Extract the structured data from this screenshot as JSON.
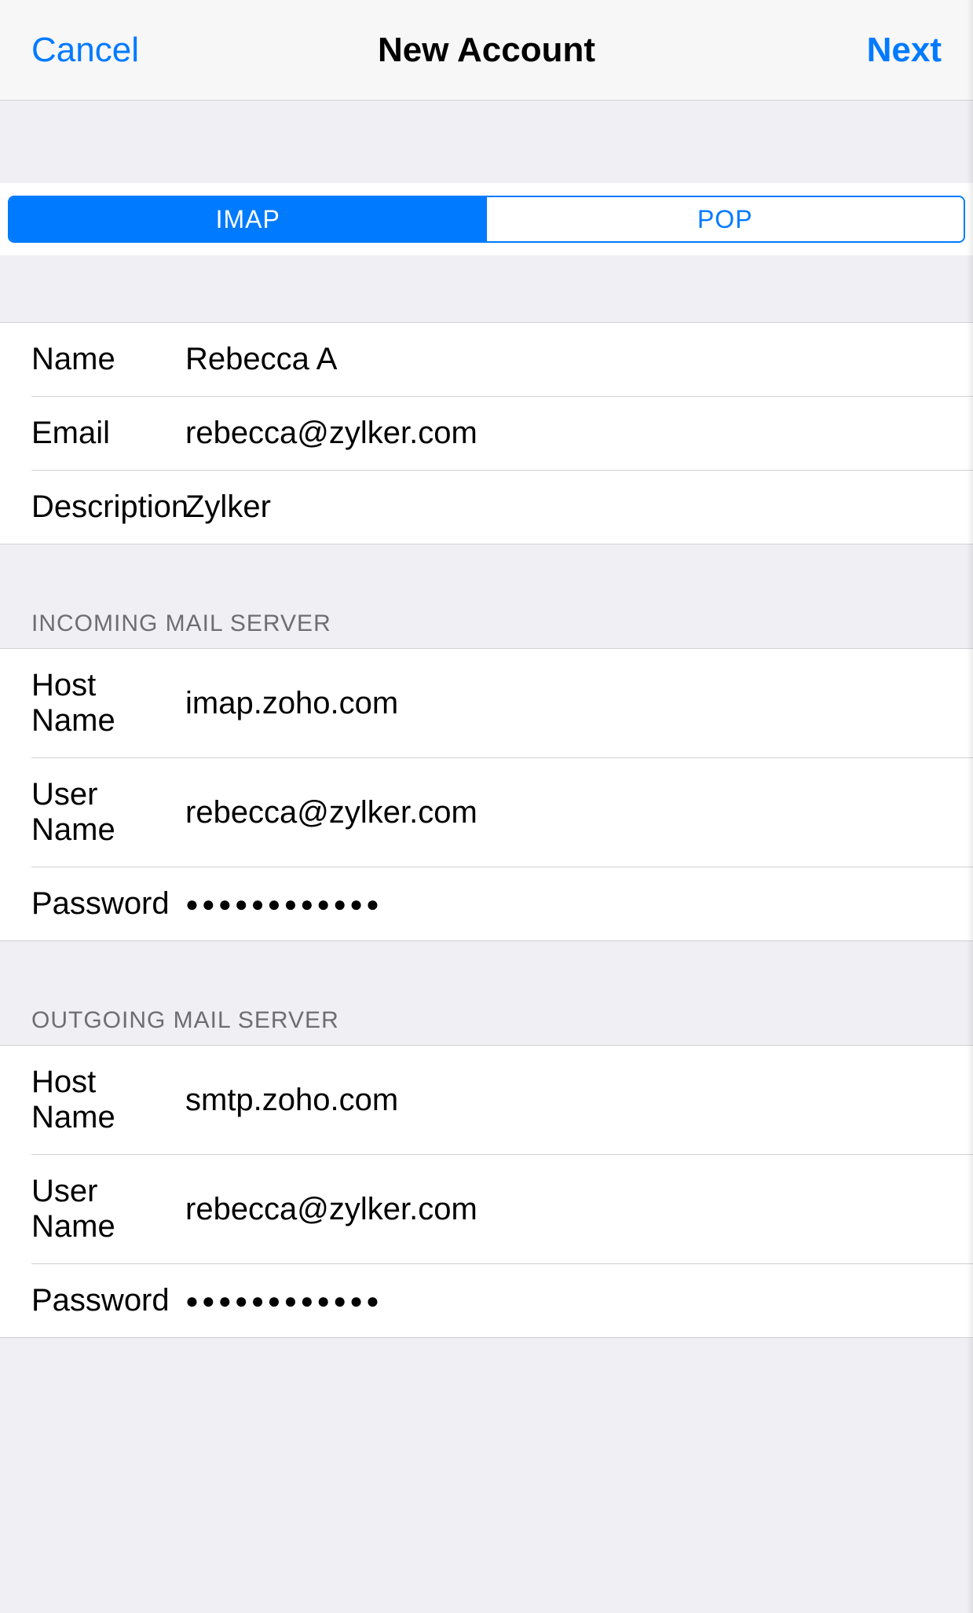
{
  "nav": {
    "cancel": "Cancel",
    "title": "New Account",
    "next": "Next"
  },
  "tabs": {
    "imap": "IMAP",
    "pop": "POP"
  },
  "account": {
    "name_label": "Name",
    "name_value": "Rebecca A",
    "email_label": "Email",
    "email_value": "rebecca@zylker.com",
    "desc_label": "Description",
    "desc_value": "Zylker"
  },
  "incoming": {
    "header": "INCOMING MAIL SERVER",
    "host_label": "Host Name",
    "host_value": "imap.zoho.com",
    "user_label": "User Name",
    "user_value": "rebecca@zylker.com",
    "pass_label": "Password",
    "pass_value": "●●●●●●●●●●●●"
  },
  "outgoing": {
    "header": "OUTGOING MAIL SERVER",
    "host_label": "Host Name",
    "host_value": "smtp.zoho.com",
    "user_label": "User Name",
    "user_value": "rebecca@zylker.com",
    "pass_label": "Password",
    "pass_value": "●●●●●●●●●●●●"
  }
}
